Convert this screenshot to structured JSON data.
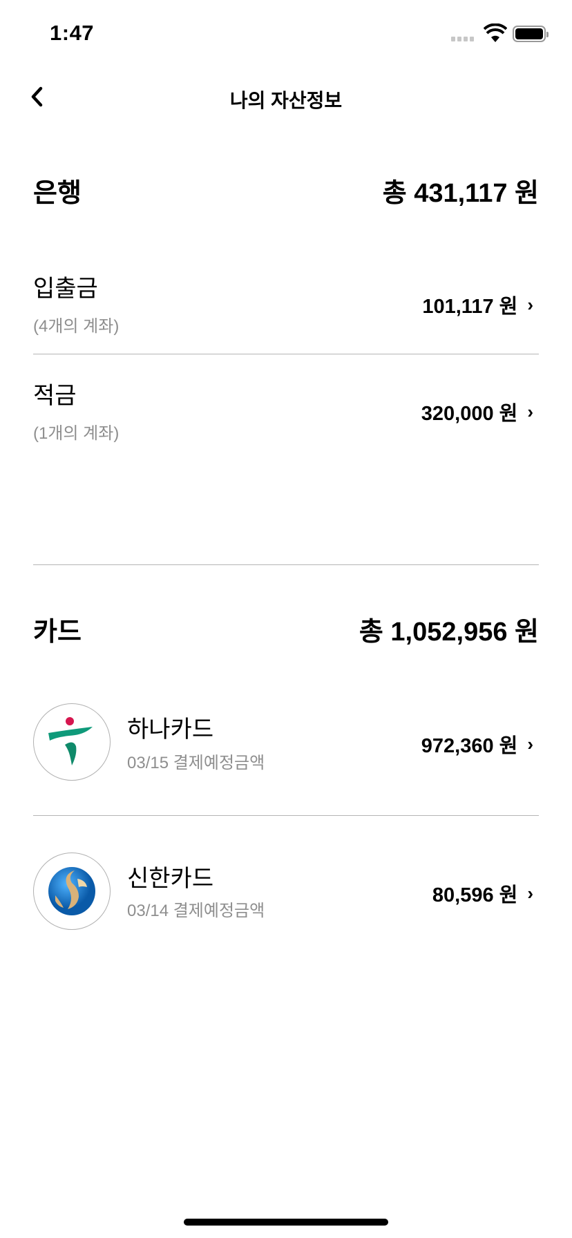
{
  "status_bar": {
    "time": "1:47"
  },
  "nav": {
    "title": "나의 자산정보"
  },
  "bank": {
    "title": "은행",
    "total": "총 431,117 원",
    "items": [
      {
        "label": "입출금",
        "sub": "(4개의 계좌)",
        "amount": "101,117 원"
      },
      {
        "label": "적금",
        "sub": "(1개의 계좌)",
        "amount": "320,000 원"
      }
    ]
  },
  "card": {
    "title": "카드",
    "total": "총 1,052,956 원",
    "items": [
      {
        "label": "하나카드",
        "sub": "03/15 결제예정금액",
        "amount": "972,360 원",
        "icon": "hana-logo"
      },
      {
        "label": "신한카드",
        "sub": "03/14 결제예정금액",
        "amount": "80,596 원",
        "icon": "shinhan-logo"
      }
    ]
  },
  "chevron": "›"
}
